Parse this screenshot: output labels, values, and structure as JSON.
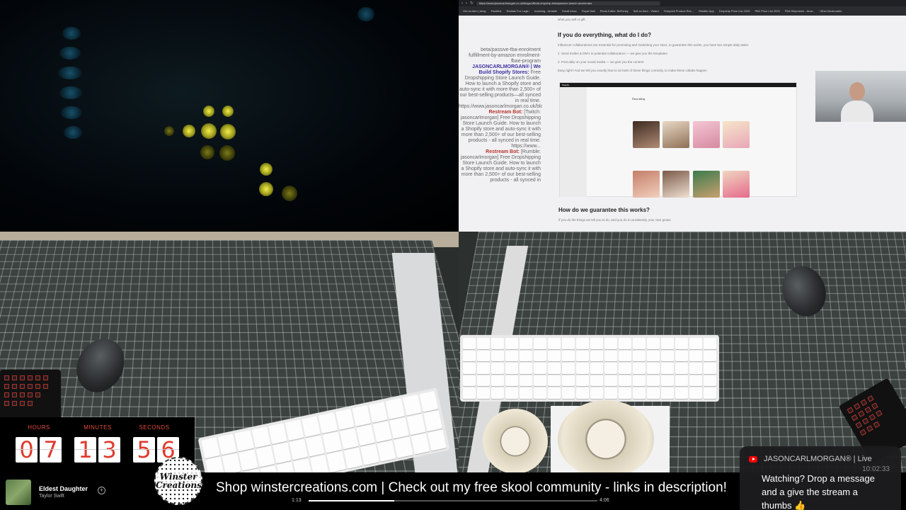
{
  "browser": {
    "url": "https://www.jasoncarlmorgan.co.uk/blogs/official-dropship-beta/passive-launch-accelerator",
    "bookmarks": [
      "Get an item | ebay",
      "Packlink",
      "Radials Fox Login",
      "Invoicing - Airtable",
      "Email inbox",
      "Royal Mail",
      "Photo Editor: BeFunky",
      "Sell an Item - Vinted",
      "Tempesti Product Res...",
      "Retailer App",
      "Dropship Price List 2025",
      "PAK Price List 2025",
      "FBA Shipments - Ama...",
      "Other Bookmarks"
    ]
  },
  "chat": {
    "messages": [
      {
        "name": "",
        "text": "beta/passive-fba-enrolment fulfillment-by-amazon enrolment-fbae-program"
      },
      {
        "name": "JASONCARLMORGAN® | We Build Shopify Stores:",
        "text": "Free Dropshipping Store Launch Guide. How to launch a Shopify store and auto-sync it with more than 2,500+ of our best-selling products—all synced in real time. https://www.jasoncarlmorgan.co.uk/blo..."
      },
      {
        "name": "Restream Bot:",
        "text": "[Twitch: jasoncarlmorgan] Free Dropshipping Store Launch Guide. How to launch a Shopify store and auto-sync it with more than 2,500+ of our best-selling products - all synced in real time. https://www..."
      },
      {
        "name": "Restream Bot:",
        "text": "[Rumble: jasoncarlmorgan] Free Dropshipping Store Launch Guide. How to launch a Shopify store and auto-sync it with more than 2,500+ of our best-selling products - all synced in"
      }
    ]
  },
  "article": {
    "intro": "what you sell or gift.",
    "heading1": "If you do everything, what do I do?",
    "para1": "Influencer collaborations are essential for promoting and marketing your store, to guarantee this works, you have two simple daily tasks:",
    "step1": "1. Send Invites & DM's to potential collaborators — we give you the templates",
    "step2": "2. Post daily on your social media — we give you the content",
    "easy": "Easy right? And we tell you exactly how to do both of these things correctly, to make these collabs happen",
    "shopify_brand": "Shopify",
    "shopify_section": "Recruiting",
    "heading2": "How do we guarantee this works?",
    "para2": "If you do the things we tell you to do, and you do it consistently, your own grows"
  },
  "timer": {
    "hours_label": "HOURS",
    "minutes_label": "MINUTES",
    "seconds_label": "SECONDS",
    "h1": "0",
    "h2": "7",
    "m1": "1",
    "m2": "3",
    "s1": "5",
    "s2": "6"
  },
  "now_playing": {
    "title": "Eldest Daughter",
    "artist": "Taylor Swift",
    "elapsed": "1:13",
    "duration": "4:06",
    "progress_fraction": 0.297,
    "add_icon": "plus-circle-icon"
  },
  "logo": {
    "text": "Winster Creations"
  },
  "ticker": {
    "text": "Shop winstercreations.com | Check out my free skool community - links in description!"
  },
  "youtube_chat": {
    "author": "JASONCARLMORGAN® | Live",
    "time": "10:02:33",
    "message": "Watching? Drop a message and a give the stream a thumbs 👍",
    "icon": "youtube-icon"
  },
  "colors": {
    "timer_digit": "#e03a2c",
    "youtube_red": "#ff0000",
    "chat_name_blue": "#3b30a0",
    "chat_name_red": "#b8322e"
  }
}
